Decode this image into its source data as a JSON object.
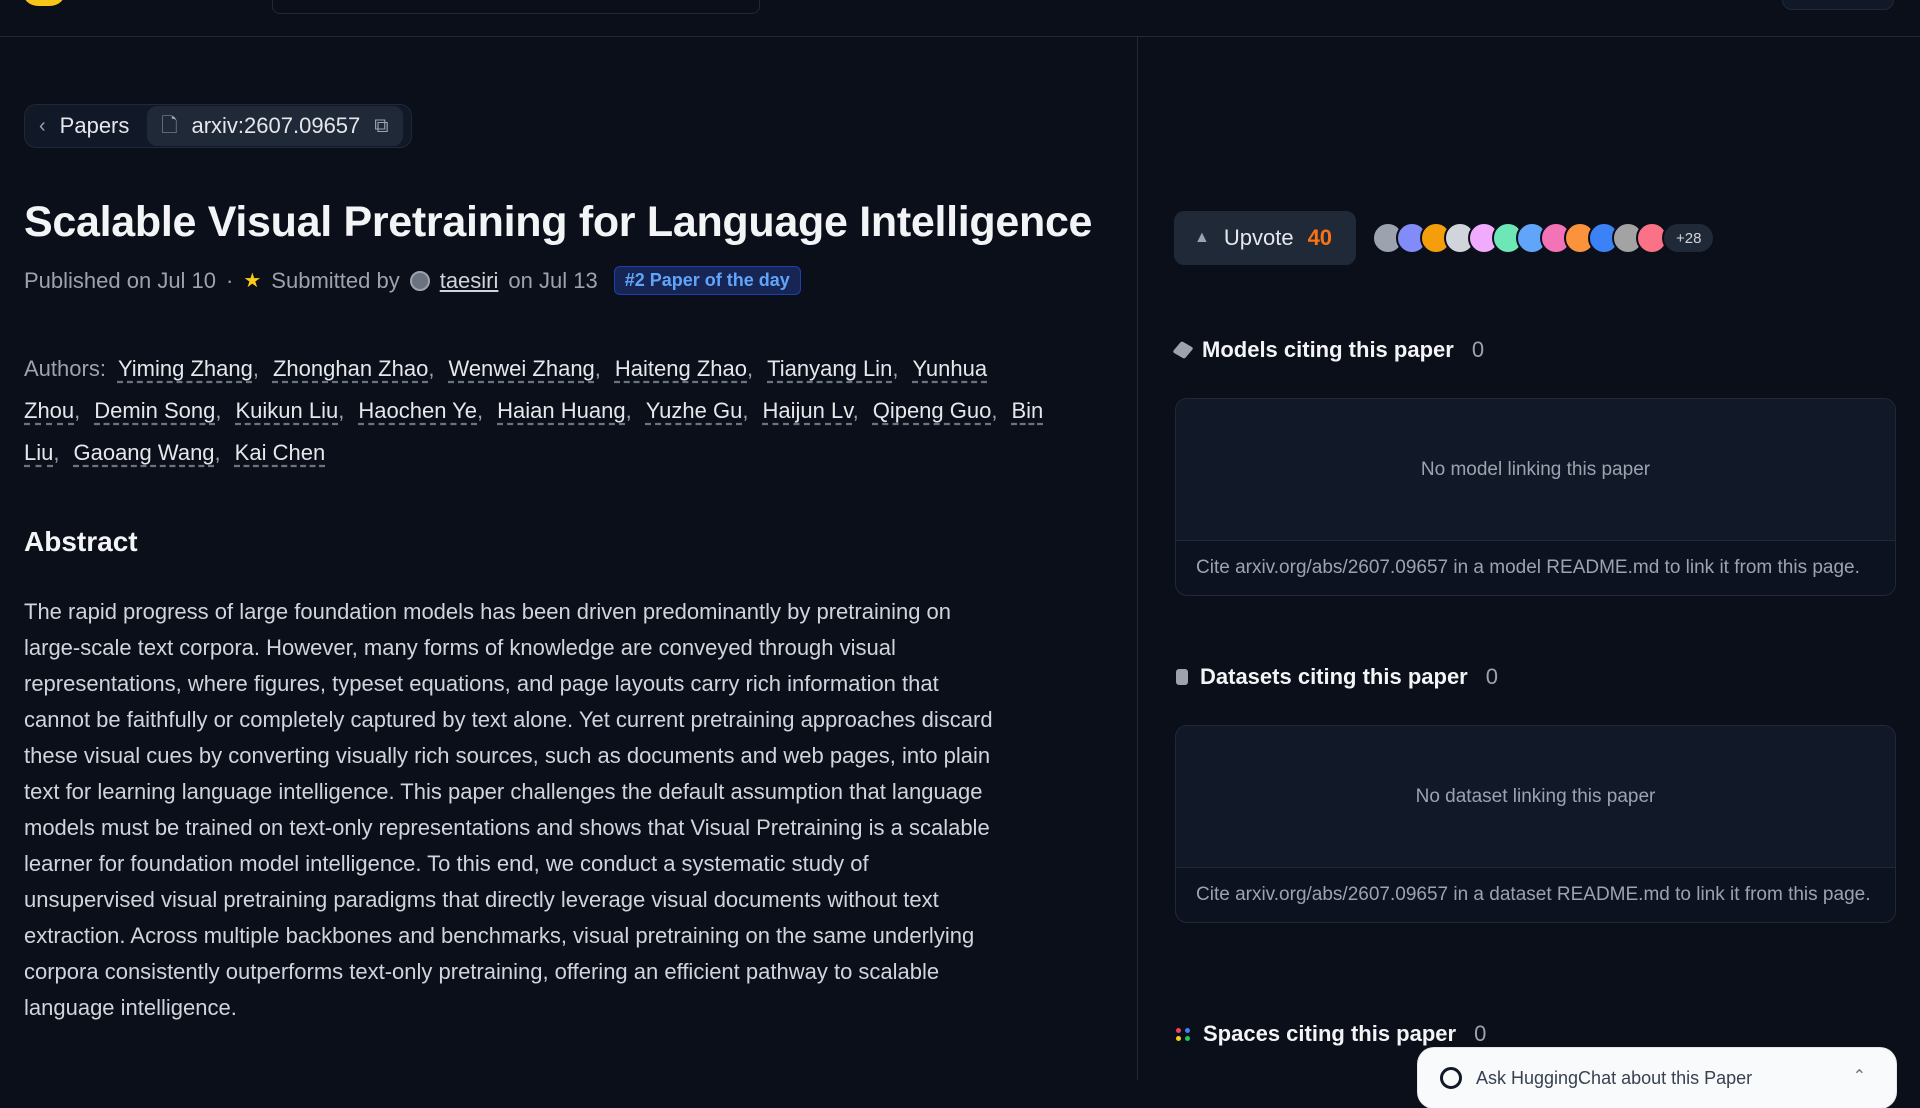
{
  "breadcrumb": {
    "back_label": "Papers",
    "arxiv_id": "arxiv:2607.09657"
  },
  "paper": {
    "title": "Scalable Visual Pretraining for Language Intelligence",
    "published": "Published on Jul 10",
    "separator": "·",
    "submitted_prefix": "Submitted by",
    "submitter": "taesiri",
    "submitted_date": "on Jul 13",
    "badge": "#2 Paper of the day",
    "authors_label": "Authors:",
    "authors": [
      "Yiming Zhang",
      "Zhonghan Zhao",
      "Wenwei Zhang",
      "Haiteng Zhao",
      "Tianyang Lin",
      "Yunhua Zhou",
      "Demin Song",
      "Kuikun Liu",
      "Haochen Ye",
      "Haian Huang",
      "Yuzhe Gu",
      "Haijun Lv",
      "Qipeng Guo",
      "Bin Liu",
      "Gaoang Wang",
      "Kai Chen"
    ],
    "abstract_heading": "Abstract",
    "abstract": "The rapid progress of large foundation models has been driven predominantly by pretraining on large-scale text corpora. However, many forms of knowledge are conveyed through visual representations, where figures, typeset equations, and page layouts carry rich information that cannot be faithfully or completely captured by text alone. Yet current pretraining approaches discard these visual cues by converting visually rich sources, such as documents and web pages, into plain text for learning language intelligence. This paper challenges the default assumption that language models must be trained on text-only representations and shows that Visual Pretraining is a scalable learner for foundation model intelligence. To this end, we conduct a systematic study of unsupervised visual pretraining paradigms that directly leverage visual documents without text extraction. Across multiple backbones and benchmarks, visual pretraining on the same underlying corpora consistently outperforms text-only pretraining, offering an efficient pathway to scalable language intelligence."
  },
  "upvote": {
    "label": "Upvote",
    "count": "40",
    "more_voters": "+28",
    "avatar_colors": [
      "#9ca3af",
      "#818cf8",
      "#f59e0b",
      "#d1d5db",
      "#f0abfc",
      "#6ee7b7",
      "#60a5fa",
      "#f472b6",
      "#fb923c",
      "#3b82f6",
      "#a3a3a3",
      "#fb7185"
    ]
  },
  "models": {
    "heading": "Models citing this paper",
    "count": "0",
    "empty": "No model linking this paper",
    "hint": "Cite arxiv.org/abs/2607.09657 in a model README.md to link it from this page."
  },
  "datasets": {
    "heading": "Datasets citing this paper",
    "count": "0",
    "empty": "No dataset linking this paper",
    "hint": "Cite arxiv.org/abs/2607.09657 in a dataset README.md to link it from this page."
  },
  "spaces": {
    "heading": "Spaces citing this paper",
    "count": "0"
  },
  "chat": {
    "placeholder": "Ask HuggingChat about this Paper"
  }
}
